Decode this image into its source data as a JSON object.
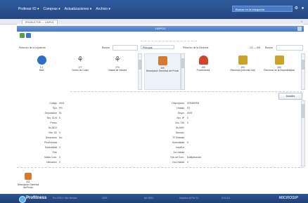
{
  "topbar": {
    "menu": [
      "Profesor IO ▾",
      "Compras ▾",
      "Actualizaciones ▾",
      "Archivo ▾"
    ],
    "search_placeholder": "Buscar en la búsqueda"
  },
  "tab": {
    "label": "PRODUCTOS — 100PO1"
  },
  "window": {
    "title": "100PO1"
  },
  "relation_left": {
    "label": "Relación de la Izquierda",
    "search_label": "Buscar",
    "select_value": "Principal"
  },
  "relation_right": {
    "label": "Relación de la Derecha",
    "range_label": "1/1 — 6/6",
    "search_label": "Buscar"
  },
  "left_cards": [
    {
      "num": "1,2",
      "label": "Mod",
      "icon": "globe-icon",
      "color": "#2f6fc8"
    },
    {
      "num": "177",
      "label": "Centro de Costo",
      "icon": "hierarchy-icon",
      "color": "#555"
    },
    {
      "num": "274",
      "label": "Clases de Valores",
      "icon": "hierarchy-icon",
      "color": "#555"
    }
  ],
  "center_card": {
    "num": "100",
    "label": "Descripción Genérica del Produ",
    "icon": "product-icon",
    "color": "#d77a2f"
  },
  "right_cards": [
    {
      "num": "100",
      "label": "Proveedores",
      "icon": "user-icon",
      "color": "#c9482b"
    },
    {
      "num": "103",
      "label": "Recursos (Intervalo Val)",
      "icon": "lock-icon",
      "color": "#c9a22b"
    },
    {
      "num": "400",
      "label": "Recursos de la Disponibilidad",
      "icon": "lock-icon",
      "color": "#c9a22b"
    }
  ],
  "detail_button": "Detalles",
  "form_left": [
    {
      "label": "Codigo",
      "value": "0001"
    },
    {
      "label": "Tipo",
      "value": "PR"
    },
    {
      "label": "Depuración",
      "value": "01"
    },
    {
      "label": "Nro. ID-N",
      "value": "0"
    },
    {
      "label": "Precio",
      "value": ""
    },
    {
      "label": "Ss-NDV",
      "value": ""
    },
    {
      "label": "Nro. 0D",
      "value": "0"
    },
    {
      "label": "Descuento",
      "value": "No"
    },
    {
      "label": "PrioEntrada",
      "value": ""
    },
    {
      "label": "Subentidad",
      "value": "0"
    },
    {
      "label": "Fols",
      "value": ""
    },
    {
      "label": "Notas Com.",
      "value": "0"
    },
    {
      "label": "Ubicación",
      "value": "0"
    }
  ],
  "form_right": [
    {
      "label": "Descripción",
      "value": "HOMEREB"
    },
    {
      "label": "Unidad",
      "value": "PZ"
    },
    {
      "label": "Grupo",
      "value": "0001"
    },
    {
      "label": "Nro. IP",
      "value": "0"
    },
    {
      "label": "Nro. TIN",
      "value": "0"
    },
    {
      "label": "Ss-NBV",
      "value": ""
    },
    {
      "label": "Servicio",
      "value": ""
    },
    {
      "label": "TF Entrada",
      "value": ""
    },
    {
      "label": "Subentidad",
      "value": "0"
    },
    {
      "label": "ImprEnt",
      "value": ""
    },
    {
      "label": "2a Unidad",
      "value": ""
    },
    {
      "label": "Tipo de Com.",
      "value": "Multiplicación"
    },
    {
      "label": "Cto.Unidad",
      "value": "0"
    }
  ],
  "bottom_card": {
    "num": "001",
    "label": "Descripción Genérica del Produ",
    "icon": "product-icon",
    "color": "#d77a2f"
  },
  "status": {
    "brand": "Profitness",
    "info": [
      "Pro 2001 / Ma Versión",
      "2021",
      "Art 0001",
      "Impreso al Pie 01",
      "01/1/24"
    ],
    "vendor": "MICROSIP"
  }
}
